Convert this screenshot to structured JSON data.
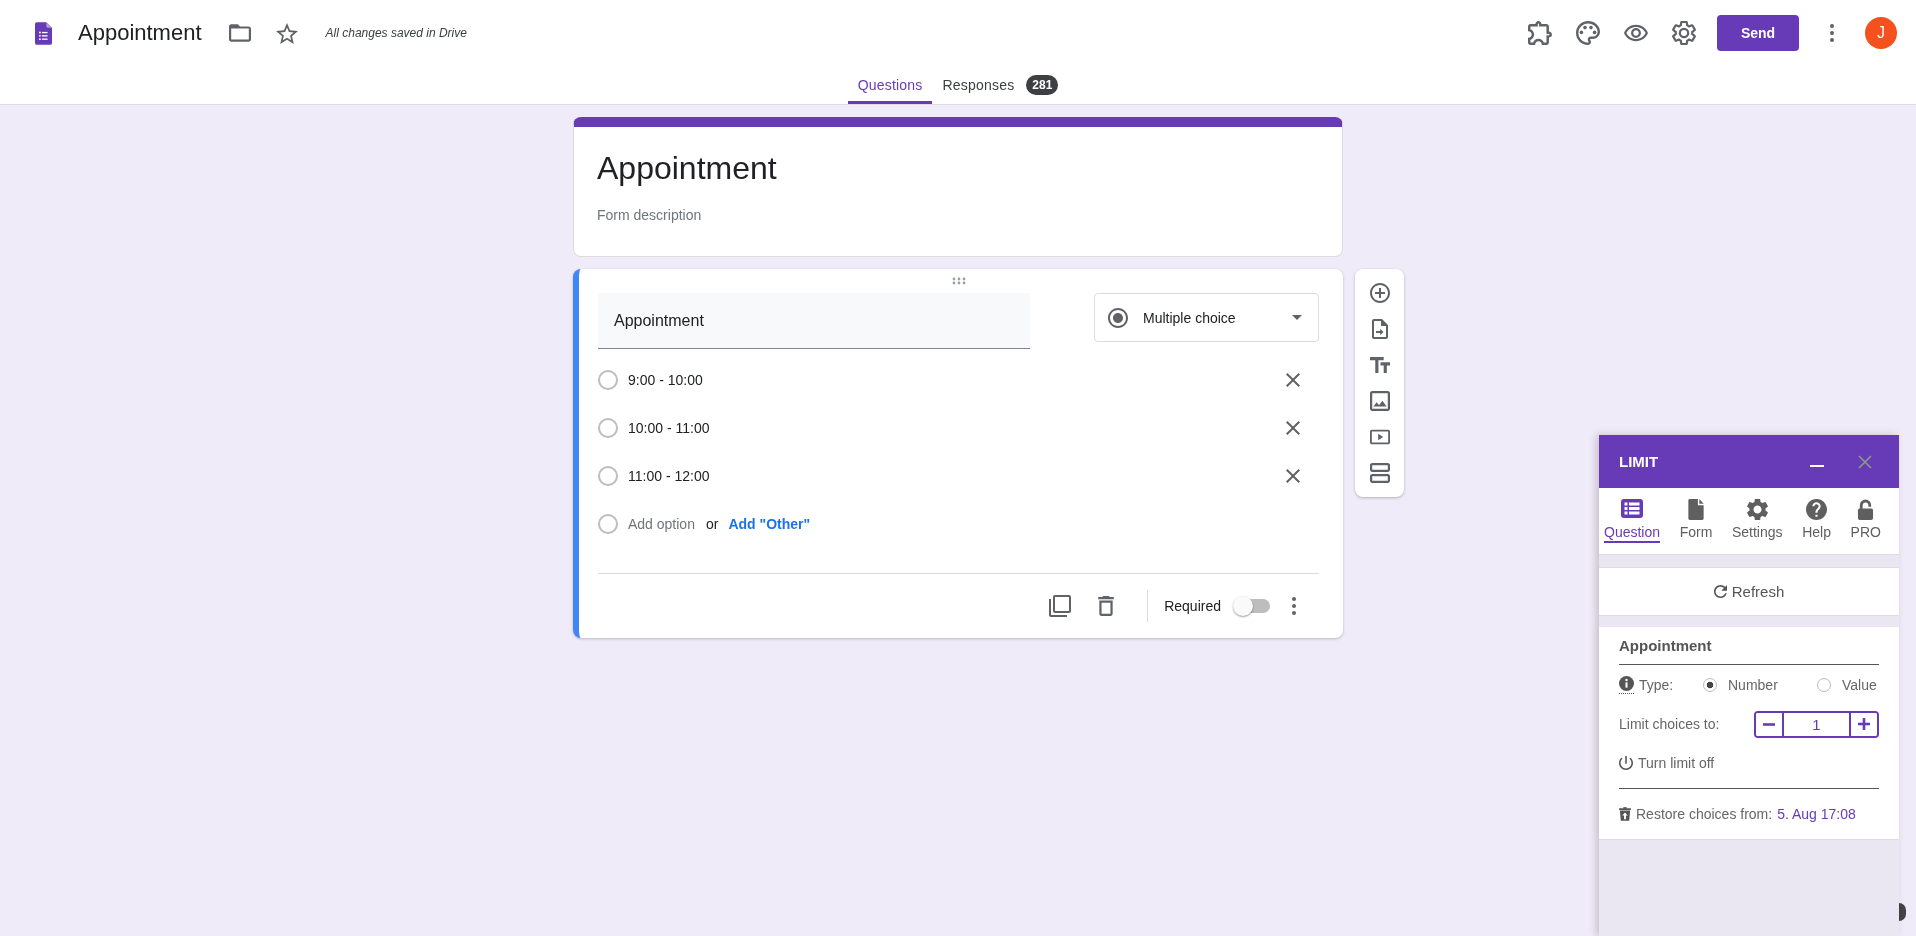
{
  "app_bar": {
    "title": "Appointment",
    "save_status": "All changes saved in Drive",
    "send_button": "Send",
    "avatar": "J"
  },
  "tabs": [
    {
      "label": "Questions",
      "selected": true
    },
    {
      "label": "Responses",
      "selected": false,
      "badge": "281"
    }
  ],
  "form_header": {
    "title": "Appointment",
    "description": {
      "placeholder": "Form description"
    }
  },
  "question": {
    "title": "Appointment",
    "type": "Multiple choice",
    "options": [
      {
        "label": "9:00 - 10:00"
      },
      {
        "label": "10:00 - 11:00"
      },
      {
        "label": "11:00 - 12:00"
      }
    ],
    "add_option": {
      "placeholder": "Add option"
    },
    "or_text": "or",
    "add_other": "Add \"Other\"",
    "required_label": "Required",
    "required": false
  },
  "limit_panel": {
    "title": "LIMIT",
    "tabs": [
      {
        "label": "Question",
        "selected": true
      },
      {
        "label": "Form",
        "selected": false
      },
      {
        "label": "Settings",
        "selected": false
      },
      {
        "label": "Help",
        "selected": false
      },
      {
        "label": "PRO",
        "selected": false
      }
    ],
    "refresh_button": "Refresh",
    "question_title": "Appointment",
    "type_label": "Type:",
    "type_options": [
      {
        "label": "Number",
        "selected": true
      },
      {
        "label": "Value",
        "selected": false
      }
    ],
    "limit_label": "Limit choices to:",
    "limit_value": "1",
    "turn_off_button": "Turn limit off",
    "restore_label": "Restore choices from:",
    "restore_link": "5. Aug 17:08"
  }
}
